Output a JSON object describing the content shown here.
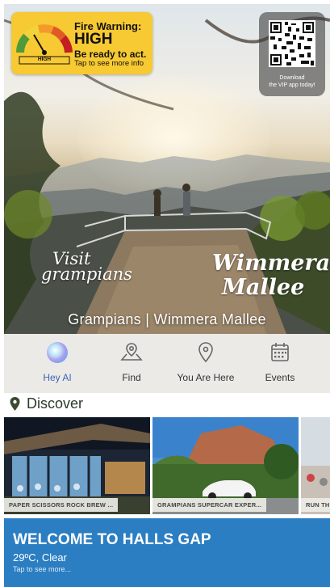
{
  "fire_warning": {
    "title": "Fire Warning:",
    "level": "HIGH",
    "gauge_label": "HIGH",
    "advice": "Be ready to act.",
    "hint": "Tap to see more info",
    "color": "#f7c932"
  },
  "qr_promo": {
    "line1": "Download",
    "line2": "the VIP app today!"
  },
  "hero": {
    "title": "Grampians | Wimmera Mallee",
    "logo_left_line1": "Visit",
    "logo_left_line2": "grampians",
    "logo_right_line1": "Wimmera",
    "logo_right_line2": "Mallee"
  },
  "nav": {
    "items": [
      {
        "label": "Hey AI",
        "icon": "ai-orb-icon"
      },
      {
        "label": "Find",
        "icon": "map-pin-fold-icon"
      },
      {
        "label": "You Are Here",
        "icon": "location-pin-icon"
      },
      {
        "label": "Events",
        "icon": "calendar-icon"
      }
    ],
    "accent": "#3a66b8"
  },
  "discover": {
    "heading": "Discover",
    "cards": [
      {
        "label": "PAPER SCISSORS ROCK BREW ..."
      },
      {
        "label": "GRAMPIANS SUPERCAR EXPER..."
      },
      {
        "label": "RUN TH"
      }
    ]
  },
  "welcome": {
    "title": "WELCOME TO HALLS GAP",
    "weather": "29ºC, Clear",
    "hint": "Tap to see more...",
    "color": "#2b7ec2"
  }
}
